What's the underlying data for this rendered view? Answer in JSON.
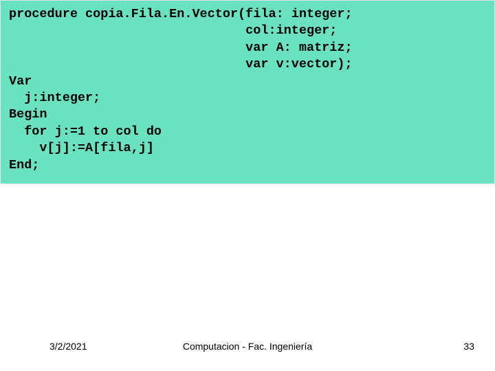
{
  "code": {
    "l1": "procedure copia.Fila.En.Vector(fila: integer;",
    "l2": "                               col:integer;",
    "l3": "                               var A: matriz;",
    "l4": "                               var v:vector);",
    "l5": "Var",
    "l6": "  j:integer;",
    "l7": "Begin",
    "l8": "  for j:=1 to col do",
    "l9": "    v[j]:=A[fila,j]",
    "l10": "End;"
  },
  "footer": {
    "date": "3/2/2021",
    "center": "Computacion  - Fac. Ingeniería",
    "page": "33"
  }
}
